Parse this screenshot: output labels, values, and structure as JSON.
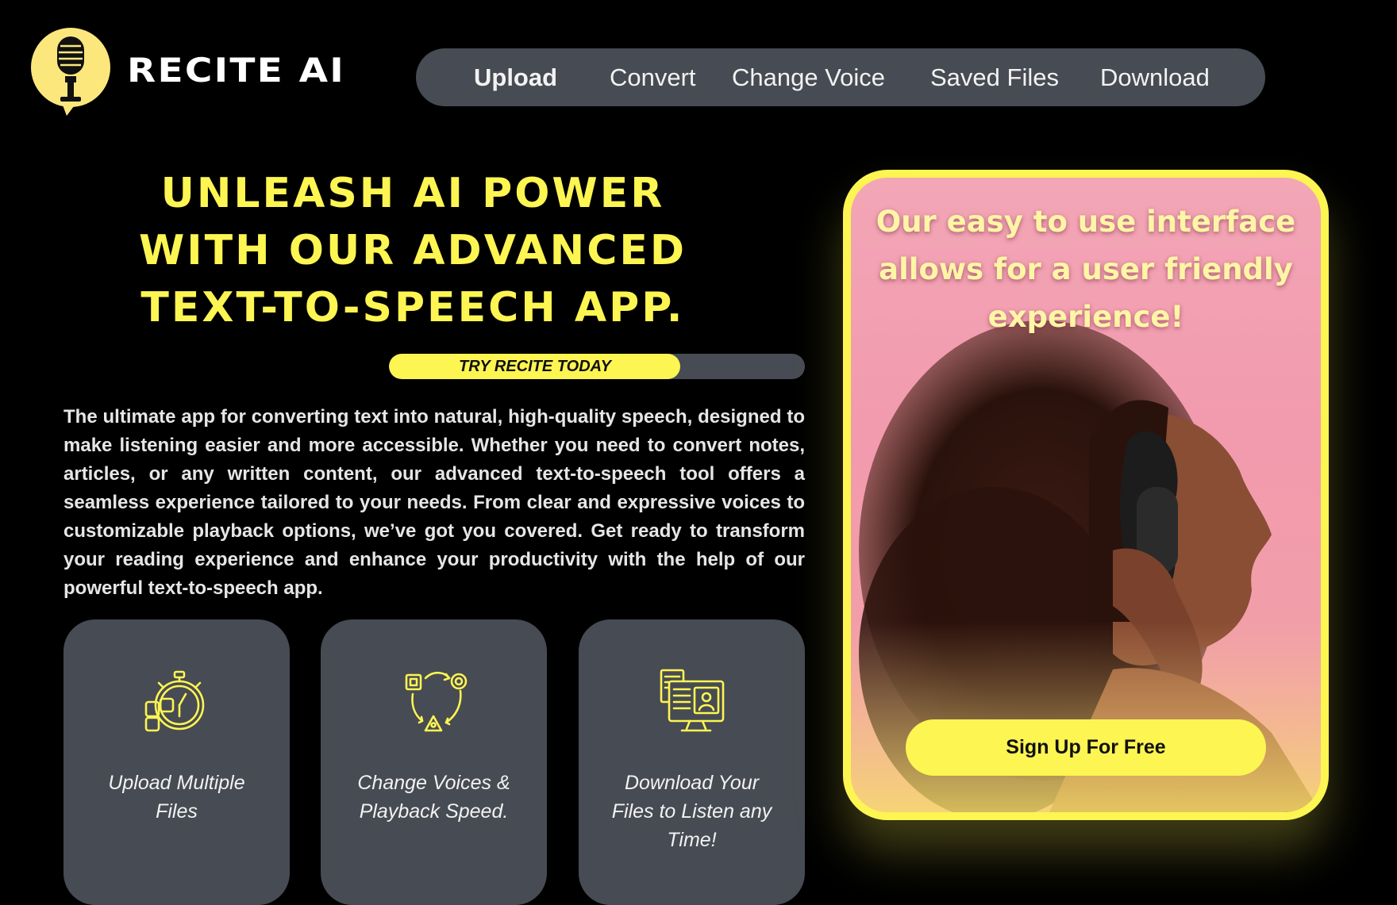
{
  "brand": {
    "name": "RECITE AI",
    "logo_icon": "microphone-icon",
    "logo_color": "#fce77d"
  },
  "nav": {
    "items": [
      {
        "label": "Upload",
        "active": true
      },
      {
        "label": "Convert"
      },
      {
        "label": "Change Voice"
      },
      {
        "label": "Saved Files"
      },
      {
        "label": "Download"
      }
    ]
  },
  "hero": {
    "title_lines": [
      "UNLEASH AI POWER",
      "WITH OUR ADVANCED",
      "TEXT-TO-SPEECH APP."
    ],
    "try_label": "TRY RECITE TODAY",
    "try_progress": 0.7,
    "description": "The ultimate app for converting text into natural, high-quality speech, designed to make listening easier and more accessible. Whether you need to convert notes, articles, or any written content, our advanced text-to-speech tool offers a seamless experience tailored to your needs. From clear and expressive voices to customizable playback options, we’ve got you covered. Get ready to transform your reading experience and enhance your productivity with the help of our powerful text-to-speech app."
  },
  "features": [
    {
      "icon": "stopwatch-icon",
      "label_lines": [
        "Upload Multiple",
        "Files"
      ]
    },
    {
      "icon": "workflow-cycle-icon",
      "label_lines": [
        "Change Voices &",
        "Playback Speed."
      ]
    },
    {
      "icon": "document-monitor-icon",
      "label_lines": [
        "Download Your",
        "Files to Listen any",
        "Time!"
      ]
    }
  ],
  "promo": {
    "text_lines": [
      "Our easy to use interface",
      "allows for a user friendly",
      "experience!"
    ],
    "cta": "Sign Up For Free"
  },
  "colors": {
    "accent": "#fdf552",
    "panel": "#474b53",
    "background": "#000000"
  }
}
